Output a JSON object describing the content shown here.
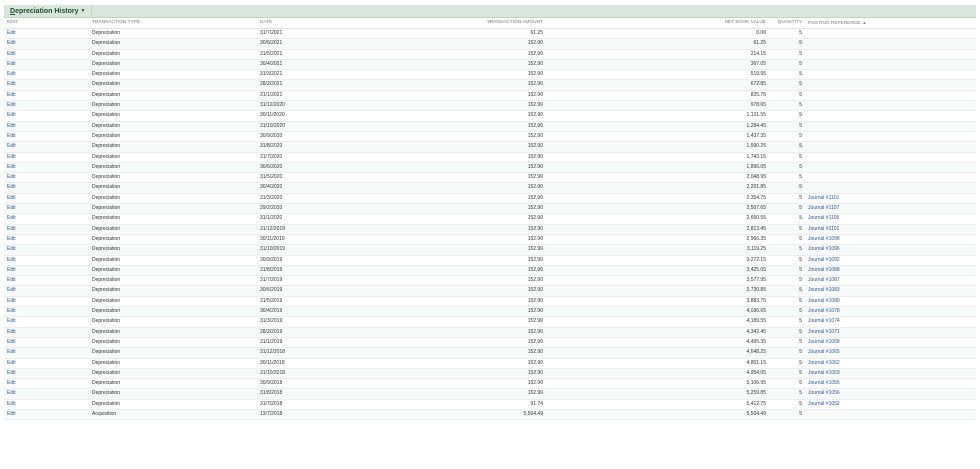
{
  "tab": {
    "label": "Depreciation History",
    "underline_char": "D",
    "rest": "epreciation History"
  },
  "columns": {
    "edit": "EDIT",
    "type": "TRANSACTION TYPE",
    "date": "DATE",
    "amount": "TRANSACTION AMOUNT",
    "nbv": "NET BOOK VALUE",
    "qty": "QUANTITY",
    "ref": "POSTING REFERENCE"
  },
  "sort_indicator": "▲",
  "rows": [
    {
      "edit": "Edit",
      "type": "Depreciation",
      "date": "31/7/2021",
      "amount": "61.25",
      "nbv": "0.00",
      "qty": "5",
      "ref": ""
    },
    {
      "edit": "Edit",
      "type": "Depreciation",
      "date": "30/6/2021",
      "amount": "152.90",
      "nbv": "61.25",
      "qty": "5",
      "ref": ""
    },
    {
      "edit": "Edit",
      "type": "Depreciation",
      "date": "31/5/2021",
      "amount": "152.90",
      "nbv": "214.15",
      "qty": "5",
      "ref": ""
    },
    {
      "edit": "Edit",
      "type": "Depreciation",
      "date": "30/4/2021",
      "amount": "152.90",
      "nbv": "367.05",
      "qty": "5",
      "ref": ""
    },
    {
      "edit": "Edit",
      "type": "Depreciation",
      "date": "31/3/2021",
      "amount": "152.90",
      "nbv": "519.95",
      "qty": "5",
      "ref": ""
    },
    {
      "edit": "Edit",
      "type": "Depreciation",
      "date": "28/2/2021",
      "amount": "152.90",
      "nbv": "672.85",
      "qty": "5",
      "ref": ""
    },
    {
      "edit": "Edit",
      "type": "Depreciation",
      "date": "31/1/2021",
      "amount": "152.90",
      "nbv": "825.75",
      "qty": "5",
      "ref": ""
    },
    {
      "edit": "Edit",
      "type": "Depreciation",
      "date": "31/12/2020",
      "amount": "152.90",
      "nbv": "978.65",
      "qty": "5",
      "ref": ""
    },
    {
      "edit": "Edit",
      "type": "Depreciation",
      "date": "30/11/2020",
      "amount": "152.90",
      "nbv": "1,131.55",
      "qty": "5",
      "ref": ""
    },
    {
      "edit": "Edit",
      "type": "Depreciation",
      "date": "31/10/2020",
      "amount": "152.90",
      "nbv": "1,284.45",
      "qty": "5",
      "ref": ""
    },
    {
      "edit": "Edit",
      "type": "Depreciation",
      "date": "30/9/2020",
      "amount": "152.90",
      "nbv": "1,437.35",
      "qty": "5",
      "ref": ""
    },
    {
      "edit": "Edit",
      "type": "Depreciation",
      "date": "31/8/2020",
      "amount": "152.90",
      "nbv": "1,590.25",
      "qty": "5",
      "ref": ""
    },
    {
      "edit": "Edit",
      "type": "Depreciation",
      "date": "31/7/2020",
      "amount": "152.90",
      "nbv": "1,743.15",
      "qty": "5",
      "ref": ""
    },
    {
      "edit": "Edit",
      "type": "Depreciation",
      "date": "30/6/2020",
      "amount": "152.90",
      "nbv": "1,896.05",
      "qty": "5",
      "ref": ""
    },
    {
      "edit": "Edit",
      "type": "Depreciation",
      "date": "31/5/2020",
      "amount": "152.90",
      "nbv": "2,048.95",
      "qty": "5",
      "ref": ""
    },
    {
      "edit": "Edit",
      "type": "Depreciation",
      "date": "30/4/2020",
      "amount": "152.90",
      "nbv": "2,201.85",
      "qty": "5",
      "ref": ""
    },
    {
      "edit": "Edit",
      "type": "Depreciation",
      "date": "31/3/2020",
      "amount": "152.90",
      "nbv": "2,354.75",
      "qty": "5",
      "ref": "Journal #1110"
    },
    {
      "edit": "Edit",
      "type": "Depreciation",
      "date": "29/2/2020",
      "amount": "152.90",
      "nbv": "2,507.65",
      "qty": "5",
      "ref": "Journal #1107"
    },
    {
      "edit": "Edit",
      "type": "Depreciation",
      "date": "31/1/2020",
      "amount": "152.90",
      "nbv": "2,660.55",
      "qty": "5",
      "ref": "Journal #1105"
    },
    {
      "edit": "Edit",
      "type": "Depreciation",
      "date": "31/12/2019",
      "amount": "152.90",
      "nbv": "2,813.45",
      "qty": "5",
      "ref": "Journal #1101"
    },
    {
      "edit": "Edit",
      "type": "Depreciation",
      "date": "30/11/2019",
      "amount": "152.90",
      "nbv": "2,966.35",
      "qty": "5",
      "ref": "Journal #1098"
    },
    {
      "edit": "Edit",
      "type": "Depreciation",
      "date": "31/10/2019",
      "amount": "152.90",
      "nbv": "3,119.25",
      "qty": "5",
      "ref": "Journal #1096"
    },
    {
      "edit": "Edit",
      "type": "Depreciation",
      "date": "30/9/2019",
      "amount": "152.90",
      "nbv": "3,272.15",
      "qty": "5",
      "ref": "Journal #1092"
    },
    {
      "edit": "Edit",
      "type": "Depreciation",
      "date": "31/8/2019",
      "amount": "152.90",
      "nbv": "3,425.05",
      "qty": "5",
      "ref": "Journal #1088"
    },
    {
      "edit": "Edit",
      "type": "Depreciation",
      "date": "31/7/2019",
      "amount": "152.90",
      "nbv": "3,577.95",
      "qty": "5",
      "ref": "Journal #1087"
    },
    {
      "edit": "Edit",
      "type": "Depreciation",
      "date": "30/6/2019",
      "amount": "152.90",
      "nbv": "3,730.85",
      "qty": "5",
      "ref": "Journal #1083"
    },
    {
      "edit": "Edit",
      "type": "Depreciation",
      "date": "31/5/2019",
      "amount": "152.90",
      "nbv": "3,883.75",
      "qty": "5",
      "ref": "Journal #1080"
    },
    {
      "edit": "Edit",
      "type": "Depreciation",
      "date": "30/4/2019",
      "amount": "152.90",
      "nbv": "4,036.65",
      "qty": "5",
      "ref": "Journal #1078"
    },
    {
      "edit": "Edit",
      "type": "Depreciation",
      "date": "31/3/2019",
      "amount": "152.90",
      "nbv": "4,189.55",
      "qty": "5",
      "ref": "Journal #1074"
    },
    {
      "edit": "Edit",
      "type": "Depreciation",
      "date": "28/2/2019",
      "amount": "152.90",
      "nbv": "4,342.45",
      "qty": "5",
      "ref": "Journal #1071"
    },
    {
      "edit": "Edit",
      "type": "Depreciation",
      "date": "31/1/2019",
      "amount": "152.90",
      "nbv": "4,495.35",
      "qty": "5",
      "ref": "Journal #1068"
    },
    {
      "edit": "Edit",
      "type": "Depreciation",
      "date": "31/12/2018",
      "amount": "152.90",
      "nbv": "4,648.25",
      "qty": "5",
      "ref": "Journal #1065"
    },
    {
      "edit": "Edit",
      "type": "Depreciation",
      "date": "30/11/2018",
      "amount": "152.90",
      "nbv": "4,801.15",
      "qty": "5",
      "ref": "Journal #1062"
    },
    {
      "edit": "Edit",
      "type": "Depreciation",
      "date": "31/10/2018",
      "amount": "152.90",
      "nbv": "4,954.05",
      "qty": "5",
      "ref": "Journal #1059"
    },
    {
      "edit": "Edit",
      "type": "Depreciation",
      "date": "30/9/2018",
      "amount": "152.90",
      "nbv": "5,106.95",
      "qty": "5",
      "ref": "Journal #1055"
    },
    {
      "edit": "Edit",
      "type": "Depreciation",
      "date": "31/8/2018",
      "amount": "152.90",
      "nbv": "5,259.85",
      "qty": "5",
      "ref": "Journal #1056"
    },
    {
      "edit": "Edit",
      "type": "Depreciation",
      "date": "31/7/2018",
      "amount": "91.74",
      "nbv": "5,412.75",
      "qty": "5",
      "ref": "Journal #1052"
    },
    {
      "edit": "Edit",
      "type": "Acquisition",
      "date": "13/7/2018",
      "amount": "5,504.49",
      "nbv": "5,504.49",
      "qty": "5",
      "ref": ""
    }
  ]
}
